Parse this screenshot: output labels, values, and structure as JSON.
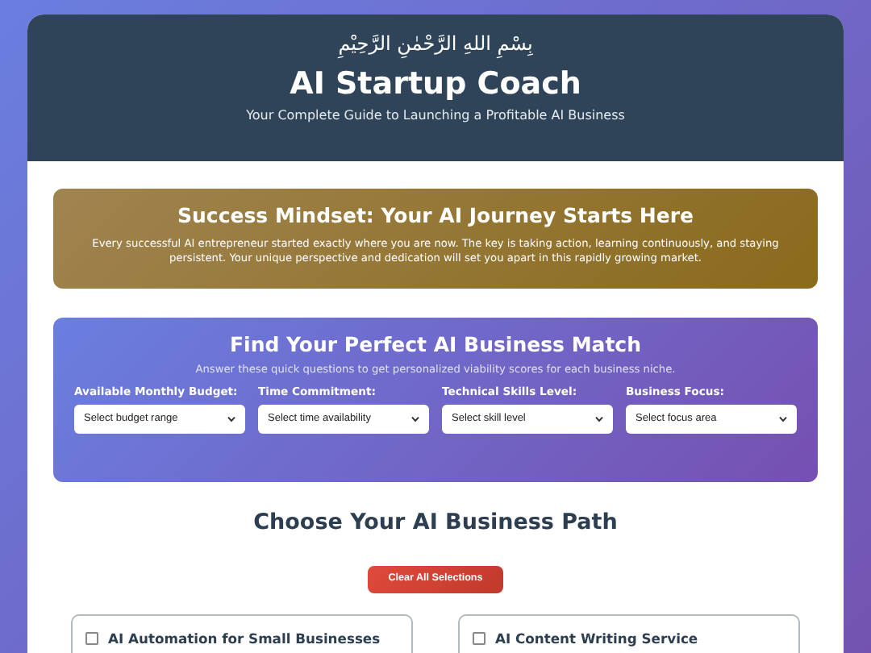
{
  "header": {
    "bismillah": "بِسْمِ اللهِ الرَّحْمٰنِ الرَّحِيْمِ",
    "title": "AI Startup Coach",
    "subtitle": "Your Complete Guide to Launching a Profitable AI Business"
  },
  "mindset": {
    "title": "Success Mindset: Your AI Journey Starts Here",
    "text": "Every successful AI entrepreneur started exactly where you are now. The key is taking action, learning continuously, and staying persistent. Your unique perspective and dedication will set you apart in this rapidly growing market."
  },
  "match": {
    "title": "Find Your Perfect AI Business Match",
    "subtitle": "Answer these quick questions to get personalized viability scores for each business niche.",
    "fields": [
      {
        "label": "Available Monthly Budget:",
        "placeholder": "Select budget range"
      },
      {
        "label": "Time Commitment:",
        "placeholder": "Select time availability"
      },
      {
        "label": "Technical Skills Level:",
        "placeholder": "Select skill level"
      },
      {
        "label": "Business Focus:",
        "placeholder": "Select focus area"
      }
    ]
  },
  "paths": {
    "title": "Choose Your AI Business Path",
    "clear_button": "Clear All Selections",
    "options": [
      {
        "label": "AI Automation for Small Businesses",
        "checked": false
      },
      {
        "label": "AI Content Writing Service",
        "checked": false
      }
    ]
  }
}
